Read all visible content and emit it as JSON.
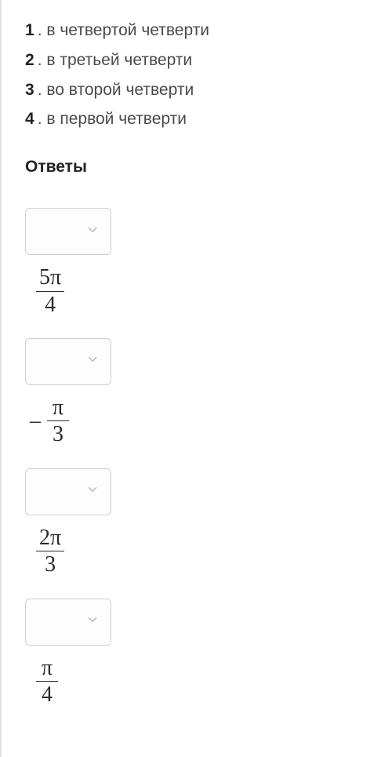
{
  "options": [
    {
      "number": "1",
      "text": ". в четвертой четверти"
    },
    {
      "number": "2",
      "text": ". в третьей четверти"
    },
    {
      "number": "3",
      "text": ". во второй четверти"
    },
    {
      "number": "4",
      "text": ". в первой четверти"
    }
  ],
  "answers_heading": "Ответы",
  "answers": [
    {
      "sign": "",
      "num": "5π",
      "den": "4"
    },
    {
      "sign": "–",
      "num": "π",
      "den": "3"
    },
    {
      "sign": "",
      "num": "2π",
      "den": "3"
    },
    {
      "sign": "",
      "num": "π",
      "den": "4"
    }
  ],
  "select_placeholder": ""
}
